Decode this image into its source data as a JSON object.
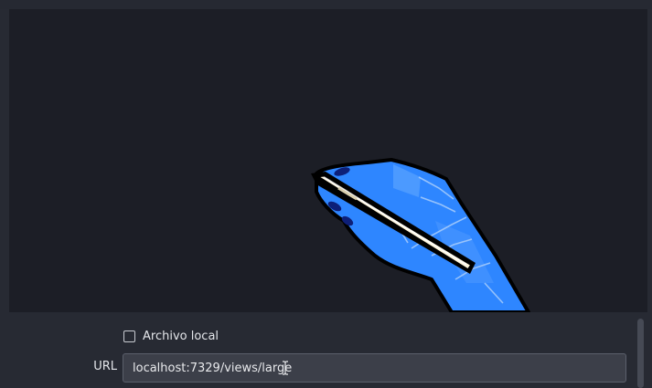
{
  "preview": {
    "image_icon": "hand-holding-pen-icon"
  },
  "properties": {
    "local_file": {
      "label": "Archivo local",
      "checked": false
    },
    "url": {
      "label": "URL",
      "value": "localhost:7329/views/large"
    }
  },
  "colors": {
    "preview_background": "#1c1e26",
    "panel_background": "#272a33",
    "input_background": "#3c3f49",
    "hand_blue": "#2e86ff",
    "pen_cream": "#fff6dc"
  }
}
